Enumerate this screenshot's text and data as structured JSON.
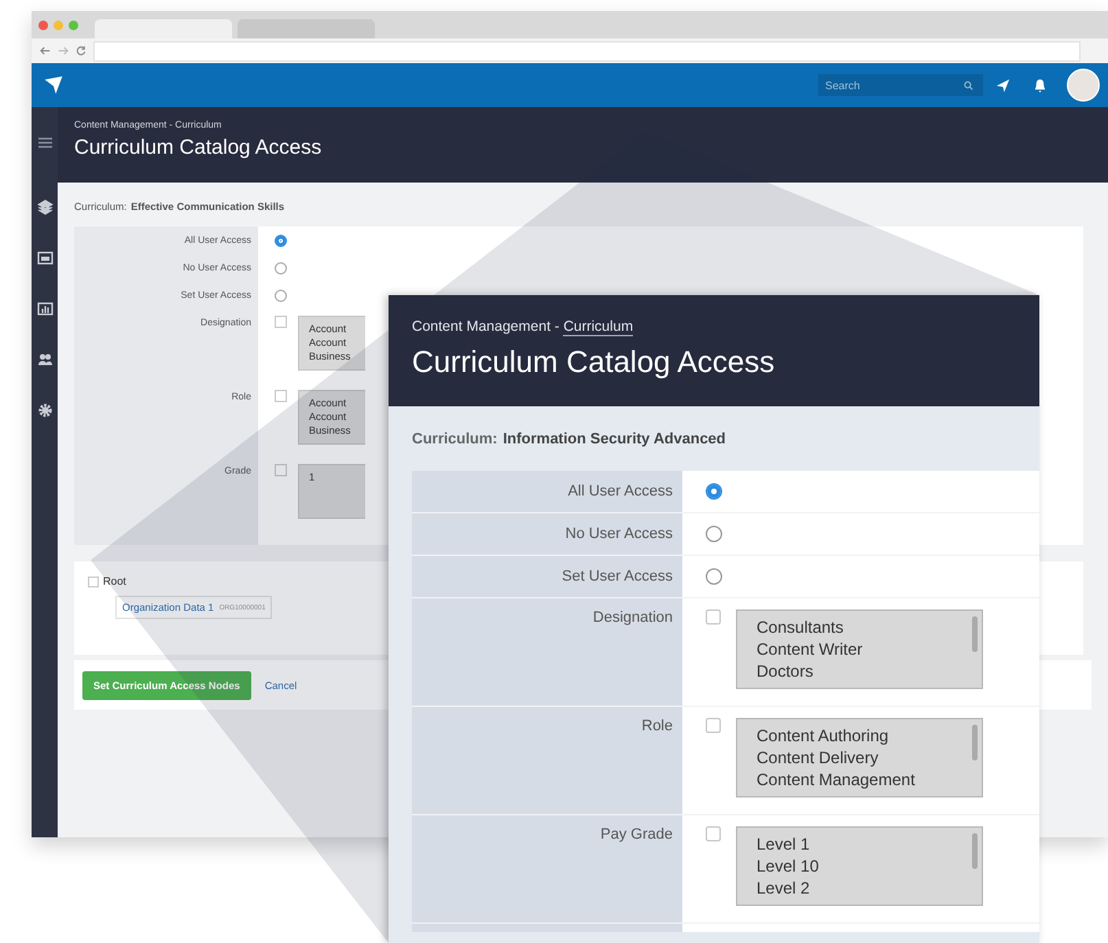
{
  "header": {
    "search_placeholder": "Search"
  },
  "background_page": {
    "breadcrumb": "Content Management - Curriculum",
    "title": "Curriculum Catalog Access",
    "curriculum_label": "Curriculum:",
    "curriculum_name": "Effective Communication Skills",
    "access_options": [
      {
        "label": "All User Access",
        "selected": true
      },
      {
        "label": "No User Access",
        "selected": false
      },
      {
        "label": "Set User Access",
        "selected": false
      }
    ],
    "filters": [
      {
        "label": "Designation",
        "checked": false,
        "options": [
          "Account",
          "Account",
          "Business"
        ]
      },
      {
        "label": "Role",
        "checked": false,
        "options": [
          "Account",
          "Account",
          "Business"
        ]
      },
      {
        "label": "Grade",
        "checked": false,
        "options": [
          "1"
        ]
      }
    ],
    "tree": {
      "root": {
        "label": "Root",
        "checked": false
      },
      "children": [
        {
          "label": "Organization Data 1",
          "code": "ORG10000001"
        }
      ]
    },
    "buttons": [
      {
        "label": "Set Curriculum Access Nodes",
        "kind": "primary"
      },
      {
        "label": "Cancel",
        "kind": "link"
      }
    ]
  },
  "zoomed_page": {
    "breadcrumb": "Content Management - ",
    "breadcrumb_link": "Curriculum",
    "title": "Curriculum Catalog Access",
    "curriculum_label": "Curriculum:",
    "curriculum_name": "Information Security Advanced",
    "access_options": [
      {
        "label": "All User Access",
        "selected": true
      },
      {
        "label": "No User Access",
        "selected": false
      },
      {
        "label": "Set User Access",
        "selected": false
      }
    ],
    "filters": [
      {
        "label": "Designation",
        "checked": false,
        "options": [
          "Consultants",
          "Content Writer",
          "Doctors"
        ]
      },
      {
        "label": "Role",
        "checked": false,
        "options": [
          "Content Authoring",
          "Content Delivery",
          "Content Management"
        ]
      },
      {
        "label": "Pay Grade",
        "checked": false,
        "options": [
          "Level 1",
          "Level 10",
          "Level 2"
        ]
      }
    ]
  }
}
